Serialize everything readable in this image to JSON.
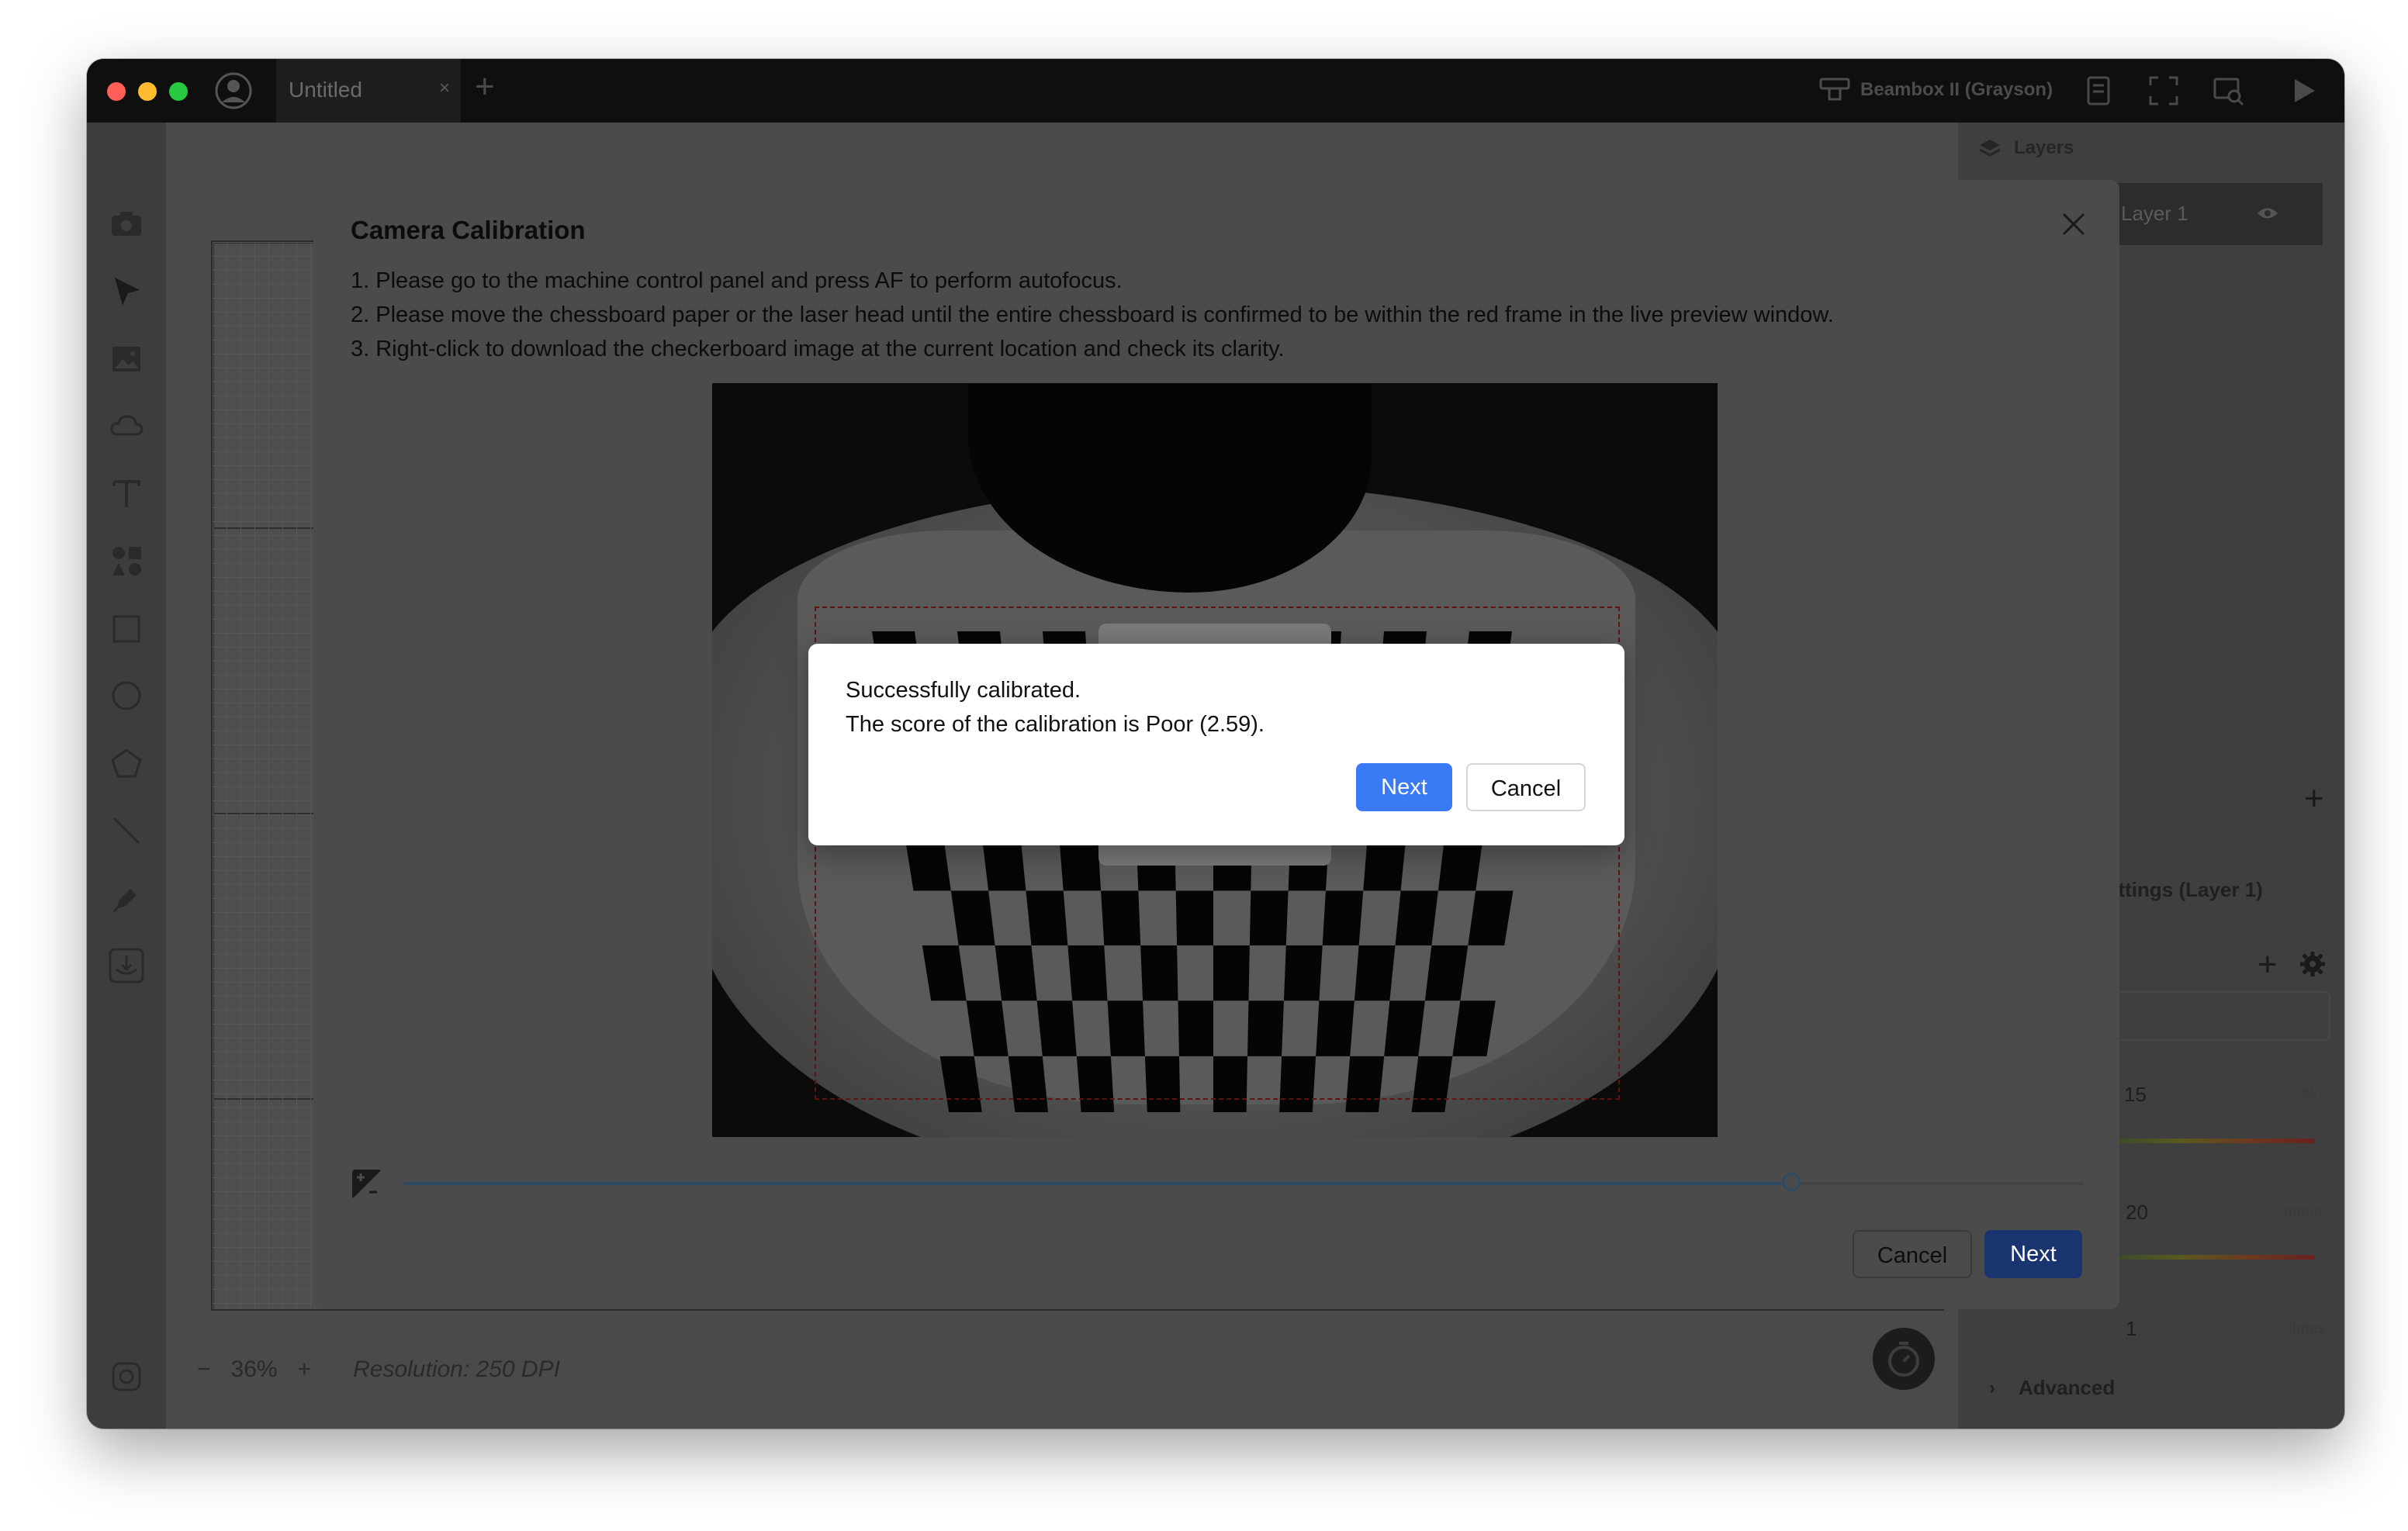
{
  "app": {
    "tab_title": "Untitled",
    "tab_close": "×",
    "tab_add": "+",
    "device_name": "Beambox II (Grayson)"
  },
  "canvas": {
    "zoom_minus": "−",
    "zoom_level": "36%",
    "zoom_plus": "+",
    "resolution": "Resolution: 250 DPI"
  },
  "right_panel": {
    "layers_title": "Layers",
    "layer_name": "Layer 1",
    "settings_title": "ettings (Layer 1)",
    "param1_value": "15",
    "param1_unit": "%",
    "param2_value": "20",
    "param2_unit": "mm/s",
    "param3_value": "1",
    "param3_unit": "times",
    "advanced_label": "Advanced"
  },
  "dialog": {
    "title": "Camera Calibration",
    "instructions": [
      "1. Please go to the machine control panel and press AF to perform autofocus.",
      "2. Please move the chessboard paper or the laser head until the entire chessboard is confirmed to be within the red frame in the live preview window.",
      "3. Right-click to download the checkerboard image at the current location and check its clarity."
    ],
    "exposure_level": 0.826,
    "cancel_label": "Cancel",
    "next_label": "Next"
  },
  "message": {
    "line1": "Successfully calibrated.",
    "line2": "The score of the calibration is Poor (2.59).",
    "next_label": "Next",
    "cancel_label": "Cancel"
  },
  "colors": {
    "primary_button": "#3a7af5",
    "dimmed_primary": "#19346f",
    "red_frame": "#5e1212"
  }
}
